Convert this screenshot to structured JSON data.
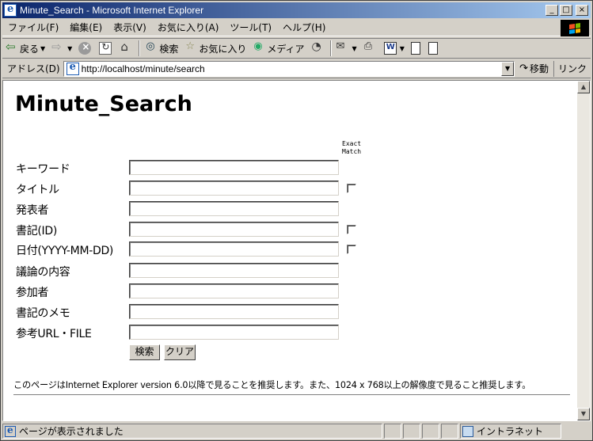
{
  "window": {
    "title": "Minute_Search - Microsoft Internet Explorer",
    "minimize": "_",
    "maximize": "□",
    "close": "×"
  },
  "menubar": [
    "ファイル(F)",
    "編集(E)",
    "表示(V)",
    "お気に入り(A)",
    "ツール(T)",
    "ヘルプ(H)"
  ],
  "toolbar": {
    "back_label": "戻る",
    "search_label": "検索",
    "favorites_label": "お気に入り",
    "media_label": "メディア"
  },
  "address": {
    "label": "アドレス(D)",
    "url": "http://localhost/minute/search",
    "go_label": "移動",
    "links_label": "リンク"
  },
  "page": {
    "title": "Minute_Search",
    "exact_match_line1": "Exact",
    "exact_match_line2": "Match",
    "fields": [
      {
        "label": "キーワード",
        "value": "",
        "exact_match_checkbox": false
      },
      {
        "label": "タイトル",
        "value": "",
        "exact_match_checkbox": true,
        "checked": false
      },
      {
        "label": "発表者",
        "value": "",
        "exact_match_checkbox": false
      },
      {
        "label": "書記(ID)",
        "value": "",
        "exact_match_checkbox": true,
        "checked": false
      },
      {
        "label": "日付(YYYY-MM-DD)",
        "value": "",
        "exact_match_checkbox": true,
        "checked": false
      },
      {
        "label": "議論の内容",
        "value": "",
        "exact_match_checkbox": false
      },
      {
        "label": "参加者",
        "value": "",
        "exact_match_checkbox": false
      },
      {
        "label": "書記のメモ",
        "value": "",
        "exact_match_checkbox": false
      },
      {
        "label": "参考URL・FILE",
        "value": "",
        "exact_match_checkbox": false
      }
    ],
    "search_button": "検索",
    "clear_button": "クリア",
    "notice": "このページはInternet Explorer version 6.0以降で見ることを推奨します。また、1024 x 768以上の解像度で見ること推奨します。"
  },
  "statusbar": {
    "message": "ページが表示されました",
    "zone": "イントラネット"
  }
}
